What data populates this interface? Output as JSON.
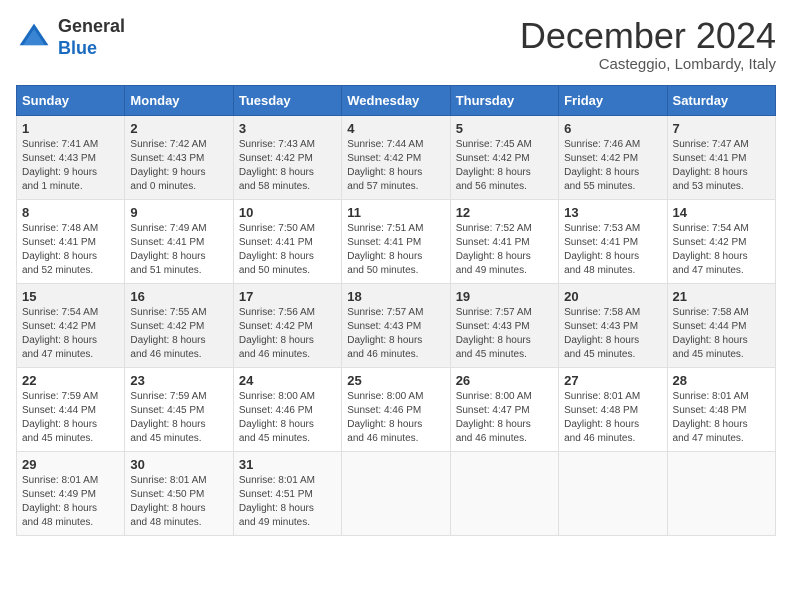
{
  "header": {
    "logo_general": "General",
    "logo_blue": "Blue",
    "month": "December 2024",
    "location": "Casteggio, Lombardy, Italy"
  },
  "days_of_week": [
    "Sunday",
    "Monday",
    "Tuesday",
    "Wednesday",
    "Thursday",
    "Friday",
    "Saturday"
  ],
  "weeks": [
    [
      {
        "day": 1,
        "info": "Sunrise: 7:41 AM\nSunset: 4:43 PM\nDaylight: 9 hours\nand 1 minute."
      },
      {
        "day": 2,
        "info": "Sunrise: 7:42 AM\nSunset: 4:43 PM\nDaylight: 9 hours\nand 0 minutes."
      },
      {
        "day": 3,
        "info": "Sunrise: 7:43 AM\nSunset: 4:42 PM\nDaylight: 8 hours\nand 58 minutes."
      },
      {
        "day": 4,
        "info": "Sunrise: 7:44 AM\nSunset: 4:42 PM\nDaylight: 8 hours\nand 57 minutes."
      },
      {
        "day": 5,
        "info": "Sunrise: 7:45 AM\nSunset: 4:42 PM\nDaylight: 8 hours\nand 56 minutes."
      },
      {
        "day": 6,
        "info": "Sunrise: 7:46 AM\nSunset: 4:42 PM\nDaylight: 8 hours\nand 55 minutes."
      },
      {
        "day": 7,
        "info": "Sunrise: 7:47 AM\nSunset: 4:41 PM\nDaylight: 8 hours\nand 53 minutes."
      }
    ],
    [
      {
        "day": 8,
        "info": "Sunrise: 7:48 AM\nSunset: 4:41 PM\nDaylight: 8 hours\nand 52 minutes."
      },
      {
        "day": 9,
        "info": "Sunrise: 7:49 AM\nSunset: 4:41 PM\nDaylight: 8 hours\nand 51 minutes."
      },
      {
        "day": 10,
        "info": "Sunrise: 7:50 AM\nSunset: 4:41 PM\nDaylight: 8 hours\nand 50 minutes."
      },
      {
        "day": 11,
        "info": "Sunrise: 7:51 AM\nSunset: 4:41 PM\nDaylight: 8 hours\nand 50 minutes."
      },
      {
        "day": 12,
        "info": "Sunrise: 7:52 AM\nSunset: 4:41 PM\nDaylight: 8 hours\nand 49 minutes."
      },
      {
        "day": 13,
        "info": "Sunrise: 7:53 AM\nSunset: 4:41 PM\nDaylight: 8 hours\nand 48 minutes."
      },
      {
        "day": 14,
        "info": "Sunrise: 7:54 AM\nSunset: 4:42 PM\nDaylight: 8 hours\nand 47 minutes."
      }
    ],
    [
      {
        "day": 15,
        "info": "Sunrise: 7:54 AM\nSunset: 4:42 PM\nDaylight: 8 hours\nand 47 minutes."
      },
      {
        "day": 16,
        "info": "Sunrise: 7:55 AM\nSunset: 4:42 PM\nDaylight: 8 hours\nand 46 minutes."
      },
      {
        "day": 17,
        "info": "Sunrise: 7:56 AM\nSunset: 4:42 PM\nDaylight: 8 hours\nand 46 minutes."
      },
      {
        "day": 18,
        "info": "Sunrise: 7:57 AM\nSunset: 4:43 PM\nDaylight: 8 hours\nand 46 minutes."
      },
      {
        "day": 19,
        "info": "Sunrise: 7:57 AM\nSunset: 4:43 PM\nDaylight: 8 hours\nand 45 minutes."
      },
      {
        "day": 20,
        "info": "Sunrise: 7:58 AM\nSunset: 4:43 PM\nDaylight: 8 hours\nand 45 minutes."
      },
      {
        "day": 21,
        "info": "Sunrise: 7:58 AM\nSunset: 4:44 PM\nDaylight: 8 hours\nand 45 minutes."
      }
    ],
    [
      {
        "day": 22,
        "info": "Sunrise: 7:59 AM\nSunset: 4:44 PM\nDaylight: 8 hours\nand 45 minutes."
      },
      {
        "day": 23,
        "info": "Sunrise: 7:59 AM\nSunset: 4:45 PM\nDaylight: 8 hours\nand 45 minutes."
      },
      {
        "day": 24,
        "info": "Sunrise: 8:00 AM\nSunset: 4:46 PM\nDaylight: 8 hours\nand 45 minutes."
      },
      {
        "day": 25,
        "info": "Sunrise: 8:00 AM\nSunset: 4:46 PM\nDaylight: 8 hours\nand 46 minutes."
      },
      {
        "day": 26,
        "info": "Sunrise: 8:00 AM\nSunset: 4:47 PM\nDaylight: 8 hours\nand 46 minutes."
      },
      {
        "day": 27,
        "info": "Sunrise: 8:01 AM\nSunset: 4:48 PM\nDaylight: 8 hours\nand 46 minutes."
      },
      {
        "day": 28,
        "info": "Sunrise: 8:01 AM\nSunset: 4:48 PM\nDaylight: 8 hours\nand 47 minutes."
      }
    ],
    [
      {
        "day": 29,
        "info": "Sunrise: 8:01 AM\nSunset: 4:49 PM\nDaylight: 8 hours\nand 48 minutes."
      },
      {
        "day": 30,
        "info": "Sunrise: 8:01 AM\nSunset: 4:50 PM\nDaylight: 8 hours\nand 48 minutes."
      },
      {
        "day": 31,
        "info": "Sunrise: 8:01 AM\nSunset: 4:51 PM\nDaylight: 8 hours\nand 49 minutes."
      },
      null,
      null,
      null,
      null
    ]
  ]
}
